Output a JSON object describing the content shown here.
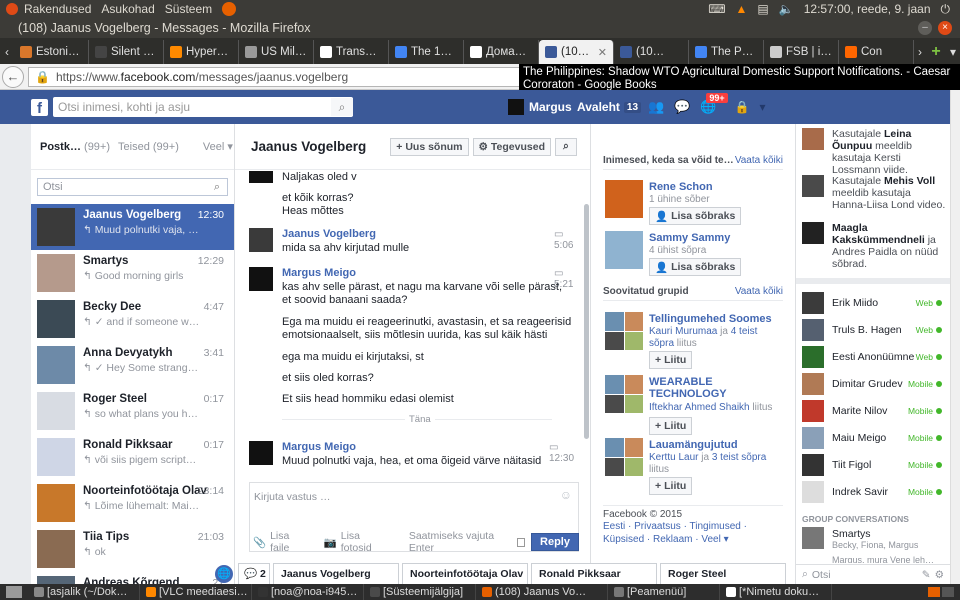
{
  "system": {
    "menus": [
      "Rakendused",
      "Asukohad",
      "Süsteem"
    ],
    "clock": "12:57:00, reede, 9. jaan"
  },
  "window": {
    "title": "(108) Jaanus Vogelberg - Messages - Mozilla Firefox"
  },
  "tabs": [
    {
      "label": "Estoni…",
      "color": "#d9772b"
    },
    {
      "label": "Silent we…",
      "color": "#444444"
    },
    {
      "label": "Hyper…",
      "color": "#ff8a00"
    },
    {
      "label": "US Mil…",
      "color": "#999999"
    },
    {
      "label": "Trans…",
      "color": "#ffffff"
    },
    {
      "label": "The 13…",
      "color": "#4285f4"
    },
    {
      "label": "Дома…",
      "color": "#ffffff"
    },
    {
      "label": "(10…",
      "color": "#3b5998"
    },
    {
      "label": "(10…",
      "color": "#3b5998"
    },
    {
      "label": "The Ph…",
      "color": "#4285f4"
    },
    {
      "label": "FSB | i…",
      "color": "#cccccc"
    },
    {
      "label": "Con",
      "color": "#ff6600"
    }
  ],
  "url": {
    "prefix": "https://www.",
    "domain": "facebook.com",
    "path": "/messages/jaanus.vogelberg"
  },
  "tooltip": "The Philippines: Shadow WTO Agricultural Domestic Support Notifications. - Caesar Cororaton - Google Books",
  "fbbar": {
    "search_placeholder": "Otsi inimesi, kohti ja asju",
    "user": "Margus",
    "home": "Avaleht",
    "home_count": "13",
    "notif_badge": "99+"
  },
  "inbox": {
    "tab_primary": "Postk…",
    "tab_primary_count": "(99+)",
    "tab_other": "Teised (99+)",
    "tab_more": "Veel",
    "search_placeholder": "Otsi",
    "conversations": [
      {
        "name": "Jaanus Vogelberg",
        "snippet": "↰ Muud polnutki vaja, hea…",
        "time": "12:30",
        "active": true,
        "color": "#3a3a3a"
      },
      {
        "name": "Smartys",
        "snippet": "↰ Good morning girls",
        "time": "12:29",
        "color": "#b59a8c"
      },
      {
        "name": "Becky Dee",
        "snippet": "↰ ✓ and if someone won…",
        "time": "4:47",
        "color": "#3b4a55"
      },
      {
        "name": "Anna Devyatykh",
        "snippet": "↰ ✓ Hey Some strange p…",
        "time": "3:41",
        "color": "#6d8aa8"
      },
      {
        "name": "Roger Steel",
        "snippet": "↰ so what plans you have…",
        "time": "0:17",
        "color": "#d8dce3"
      },
      {
        "name": "Ronald Pikksaar",
        "snippet": "↰ või siis pigem scriptual (…",
        "time": "0:17",
        "color": "#cfd6e6"
      },
      {
        "name": "Noorteinfotöötaja Olav",
        "snippet": "↰ Lõime lühemalt: Mailma…",
        "time": "23:14",
        "color": "#c8782a"
      },
      {
        "name": "Tiia Tips",
        "snippet": "↰ ok",
        "time": "21:03",
        "color": "#8a6b52"
      },
      {
        "name": "Andreas Kõrgend",
        "snippet": "",
        "time": "21",
        "color": "#556677"
      }
    ]
  },
  "chat": {
    "title": "Jaanus Vogelberg",
    "new_msg_btn": "Uus sõnum",
    "actions_btn": "Tegevused",
    "lines": [
      "Naljakas oled v",
      "et kõik korras?",
      "Heas mõttes",
      "mida sa ahv kirjutad mulle",
      "kas ahv selle pärast, et nagu ma karvane või selle pärast,",
      "et soovid banaani saada?",
      "Ega ma muidu ei reageerinutki, avastasin, et sa reageerisid",
      "emotsionaalselt, siis mõtlesin uurida, kas sul käik hästi",
      "ega ma muidu ei kirjutaksi, st",
      "et siis oled korras?",
      "Et siis head hommiku edasi olemist",
      "Muud polnutki vaja, hea, et oma õigeid värve näitasid"
    ],
    "senders": [
      "Jaanus Vogelberg",
      "Margus Meigo",
      "Margus Meigo"
    ],
    "times": [
      "5:06",
      "5:21",
      "12:30"
    ],
    "divider": "Täna",
    "reply_placeholder": "Kirjuta vastus …",
    "add_file": "Lisa faile",
    "add_photo": "Lisa fotosid",
    "enter_hint": "Saatmiseks vajuta Enter",
    "reply_btn": "Reply"
  },
  "info": {
    "people_header": "Inimesed, keda sa võid te…",
    "see_all": "Vaata kõiki",
    "people": [
      {
        "name": "Rene Schon",
        "sub": "1 ühine sõber",
        "btn": "Lisa sõbraks",
        "color": "#d0621c"
      },
      {
        "name": "Sammy Sammy",
        "sub": "4 ühist sõpra",
        "btn": "Lisa sõbraks",
        "color": "#8fb3d0"
      }
    ],
    "groups_header": "Soovitatud grupid",
    "groups": [
      {
        "name": "Tellingumehed Soomes",
        "sub1": "Kauri Murumaa",
        "sub2": "ja",
        "sub3": "4 teist sõpra",
        "sub4": "liitus",
        "btn": "Liitu"
      },
      {
        "name": "WEARABLE TECHNOLOGY",
        "sub1": "Iftekhar Ahmed Shaikh",
        "sub4": "liitus",
        "btn": "Liitu"
      },
      {
        "name": "Lauamängujutud",
        "sub1": "Kerttu Laur",
        "sub2": "ja",
        "sub3": "3 teist sõpra",
        "sub4": "liitus",
        "btn": "Liitu"
      }
    ],
    "footer_copy": "Facebook © 2015",
    "footer_links": "Eesti · Privaatsus · Tingimused · Küpsised · Reklaam · Veel ▾"
  },
  "sidebar": {
    "ticker": [
      {
        "prefix": "Kasutajale",
        "name": "Leina Õunpuu",
        "text": "meeldib kasutaja Kersti Lossmann viide.",
        "color": "#a86b4a"
      },
      {
        "prefix": "Kasutajale",
        "name": "Mehis Voll",
        "text": "meeldib kasutaja Hanna-Liisa Lond video.",
        "color": "#4a4a4a"
      },
      {
        "prefix": "",
        "name": "Maagla Kakskümmendneli",
        "text": "ja Andres Paidla on nüüd sõbrad.",
        "color": "#222222"
      }
    ],
    "friends": [
      {
        "name": "Erik Miido",
        "status": "Web",
        "color": "#3b3b3b"
      },
      {
        "name": "Truls B. Hagen",
        "status": "Web",
        "color": "#556070"
      },
      {
        "name": "Eesti Anonüümne",
        "status": "Web",
        "color": "#2b6e2b"
      },
      {
        "name": "Dimitar Grudev",
        "status": "Mobile",
        "color": "#b07a55"
      },
      {
        "name": "Marite Nilov",
        "status": "Mobile",
        "color": "#c0392b"
      },
      {
        "name": "Maiu Meigo",
        "status": "Mobile",
        "color": "#8aa0b8"
      },
      {
        "name": "Tiit Figol",
        "status": "Mobile",
        "color": "#333333"
      },
      {
        "name": "Indrek Savir",
        "status": "Mobile",
        "color": "#dddddd"
      }
    ],
    "group_conv_header": "GROUP CONVERSATIONS",
    "group_conv": [
      {
        "name": "Smartys",
        "members": "Becky, Fiona, Margus"
      }
    ],
    "group_conv_2": "Margus, mura Vene leh…",
    "search_placeholder": "Otsi"
  },
  "chat_tabs": {
    "counter": "2",
    "items": [
      "Jaanus Vogelberg",
      "Noorteinfotöötaja Olav",
      "Ronald Pikksaar",
      "Roger Steel"
    ]
  },
  "taskbar": [
    {
      "label": "[asjalik (~/Dok…",
      "color": "#888888"
    },
    {
      "label": "[VLC meediaesi…",
      "color": "#ff8800"
    },
    {
      "label": "[noa@noa-i945…",
      "color": "#333333"
    },
    {
      "label": "[Süsteemijälgija]",
      "color": "#4a4a4a"
    },
    {
      "label": "(108) Jaanus Vo…",
      "color": "#e66000"
    },
    {
      "label": "[Peamenüü]",
      "color": "#777777"
    },
    {
      "label": "[*Nimetu doku…",
      "color": "#ffffff"
    }
  ]
}
